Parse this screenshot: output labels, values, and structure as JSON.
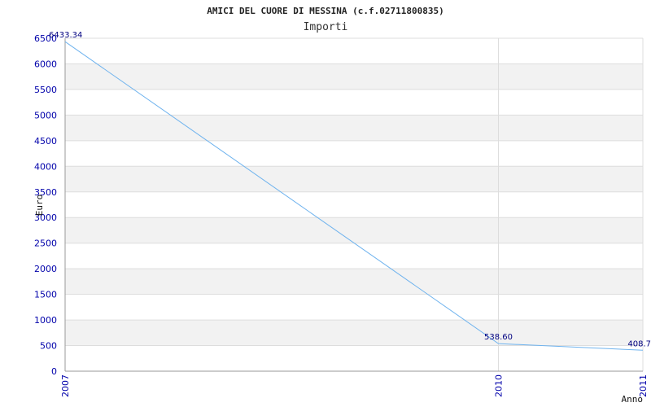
{
  "chart_data": {
    "type": "line",
    "title": "AMICI DEL CUORE DI MESSINA (c.f.02711800835)",
    "subtitle": "Importi",
    "xlabel": "Anno",
    "ylabel": "Euro",
    "categories": [
      "2007",
      "2010",
      "2011"
    ],
    "series": [
      {
        "values": [
          6433.34,
          538.6,
          408.7
        ],
        "labels": [
          "6433.34",
          "538.60",
          "408.7"
        ]
      }
    ],
    "ylim": [
      0,
      6500
    ],
    "yticks": [
      "0",
      "500",
      "1000",
      "1500",
      "2000",
      "2500",
      "3000",
      "3500",
      "4000",
      "4500",
      "5000",
      "5500",
      "6000",
      "6500"
    ],
    "grid": true,
    "legend": "none",
    "colors": {
      "line": "#6fb3ee",
      "band": "#f2f2f2",
      "grid": "#dddddd",
      "tick_text": "#0000aa",
      "data_label": "#000080"
    }
  }
}
